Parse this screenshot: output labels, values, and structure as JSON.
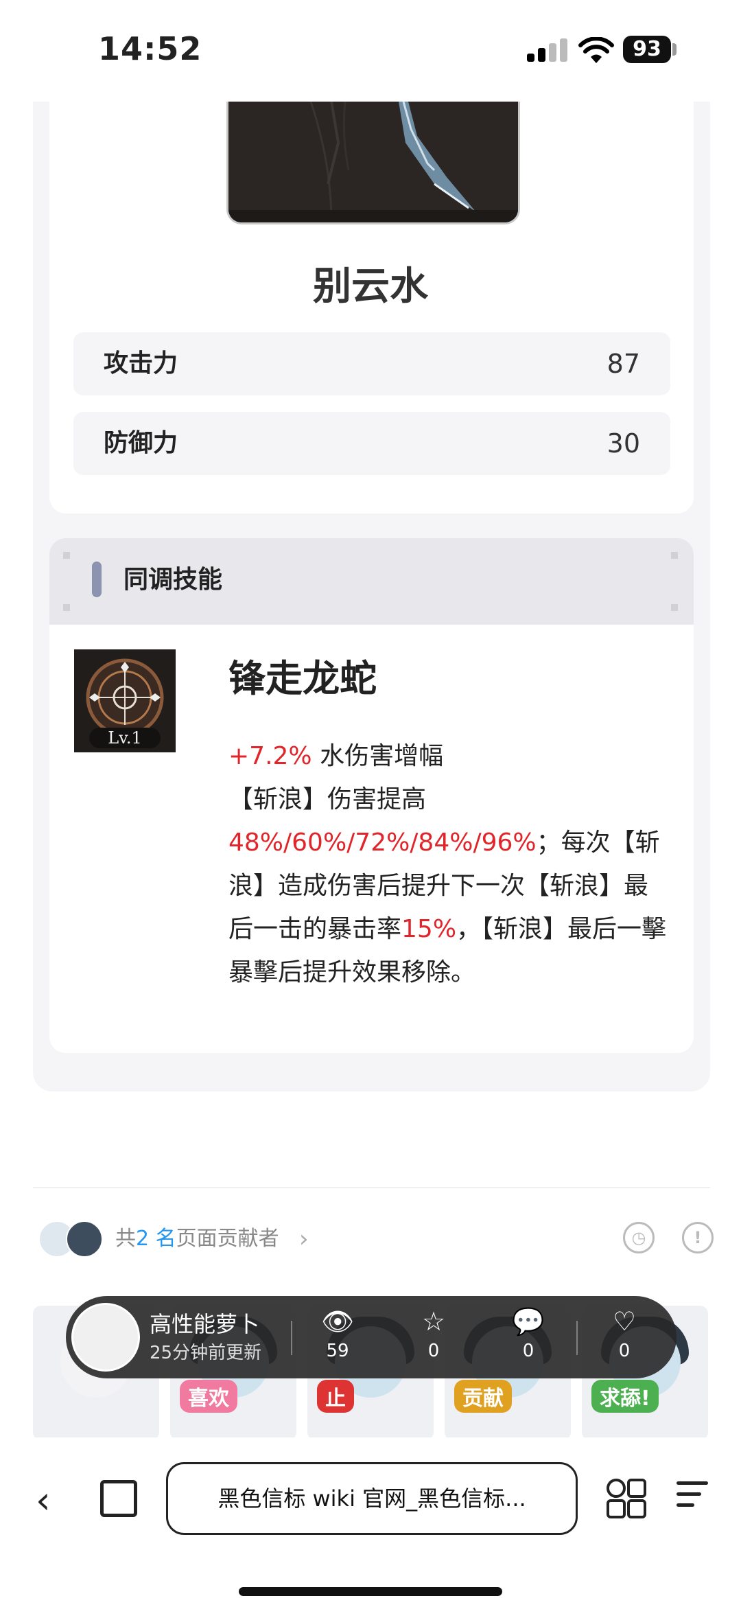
{
  "status_bar": {
    "time": "14:52",
    "battery": "93"
  },
  "weapon": {
    "name": "别云水",
    "stats": [
      {
        "label": "攻击力",
        "value": "87"
      },
      {
        "label": "防御力",
        "value": "30"
      }
    ]
  },
  "skill_section": {
    "title": "同调技能",
    "skill": {
      "name": "锋走龙蛇",
      "level": "Lv.1",
      "desc_parts": {
        "p1_red": "+7.2%",
        "p2": " 水伤害增幅",
        "p3": "【斩浪】伤害提高",
        "p4_red": "48%/60%/72%/84%/96%",
        "p5": "；每次【斩浪】造成伤害后提升下一次【斩浪】最后一击的暴击率",
        "p6_red": "15%",
        "p7": "，【斩浪】最后一擊暴擊后提升效果移除。"
      }
    }
  },
  "contributors": {
    "prefix": "共",
    "count": "2 名",
    "suffix": "页面贡献者"
  },
  "stickers": [
    {
      "name": "sticker-1",
      "tag": ""
    },
    {
      "name": "sticker-2",
      "tag": "喜欢"
    },
    {
      "name": "sticker-3",
      "tag": "止"
    },
    {
      "name": "sticker-4",
      "tag": "贡献"
    },
    {
      "name": "sticker-5",
      "tag": "求舔!"
    }
  ],
  "float_bar": {
    "user": "高性能萝卜",
    "updated": "25分钟前更新",
    "views": "59",
    "stars": "0",
    "comments": "0",
    "likes": "0"
  },
  "browser": {
    "url_title": "黑色信标 wiki 官网_黑色信标..."
  },
  "colors": {
    "accent_red": "#e0262b",
    "accent_blue": "#2196f3",
    "section_bar": "#8b93b0"
  }
}
